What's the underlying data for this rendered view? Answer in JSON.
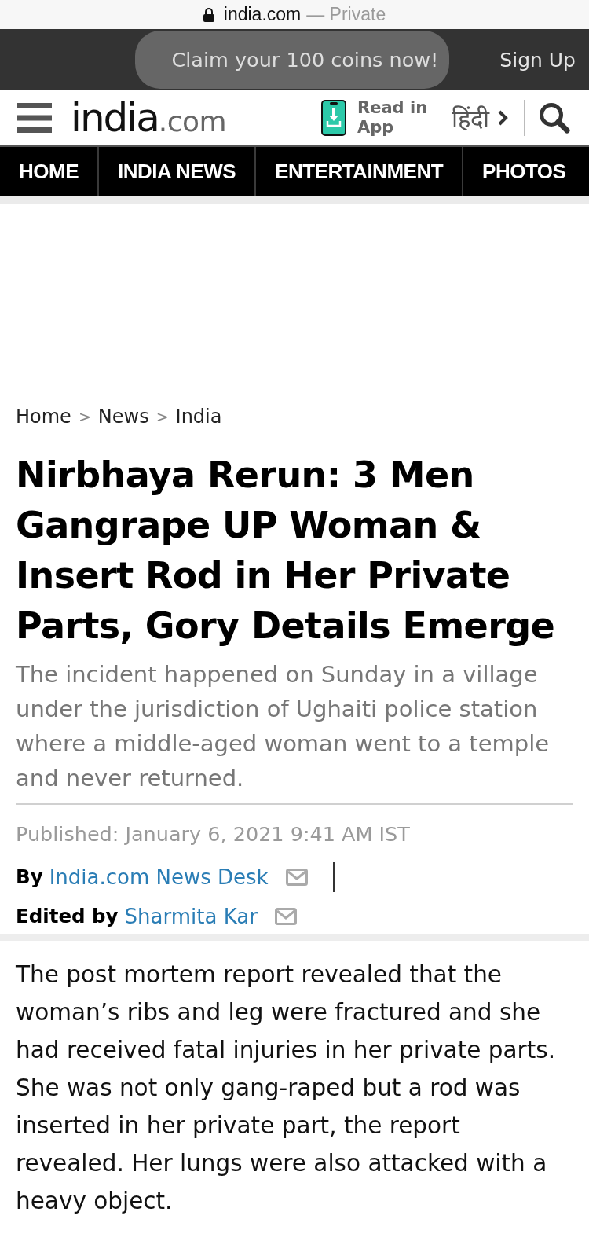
{
  "browser_bar": {
    "url": "india.com",
    "mode": "— Private"
  },
  "promo_bar": {
    "offer": "Claim your 100 coins now!",
    "sign_up": "Sign Up"
  },
  "header": {
    "logo": {
      "name": "india",
      "domain": ".com"
    },
    "app_link": "Read in App",
    "language_link": "हिंदी"
  },
  "nav": [
    "HOME",
    "INDIA NEWS",
    "ENTERTAINMENT",
    "PHOTOS"
  ],
  "breadcrumb": {
    "items": [
      "Home",
      "News",
      "India"
    ],
    "separators": [
      ">",
      ">"
    ]
  },
  "article": {
    "title": "Nirbhaya Rerun: 3 Men Gangrape UP Woman & Insert Rod in Her Private Parts, Gory Details Emerge",
    "summary": "The incident happened on Sunday in a village under the jurisdiction of Ughaiti police station where a middle-aged woman went to a temple and never returned.",
    "published": "Published: January 6, 2021 9:41 AM IST",
    "credits": [
      {
        "prefix": "By",
        "name": "India.com News Desk"
      },
      {
        "prefix": "Edited by",
        "name": "Sharmita Kar"
      }
    ],
    "body": "The post mortem report revealed that the woman’s ribs and leg were fractured and she had received fatal injuries in her private parts. She was not only gang-raped but a rod was inserted in her private part, the report revealed. Her lungs were also attacked with a heavy object."
  }
}
